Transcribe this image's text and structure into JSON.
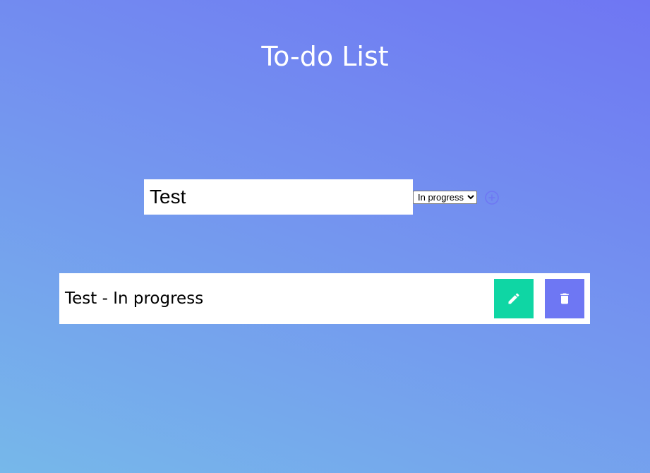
{
  "page": {
    "title": "To-do List"
  },
  "form": {
    "input_value": "Test",
    "status_options": [
      "In progress"
    ],
    "selected_status": "In progress",
    "add_icon": "plus-circle-icon"
  },
  "todos": [
    {
      "text": "Test - In progress",
      "edit_icon": "pencil-icon",
      "delete_icon": "trash-icon"
    }
  ],
  "colors": {
    "edit_button": "#0fd6a4",
    "delete_button": "#6e77f3",
    "add_icon": "#6e77f3",
    "title": "#ffffff"
  }
}
